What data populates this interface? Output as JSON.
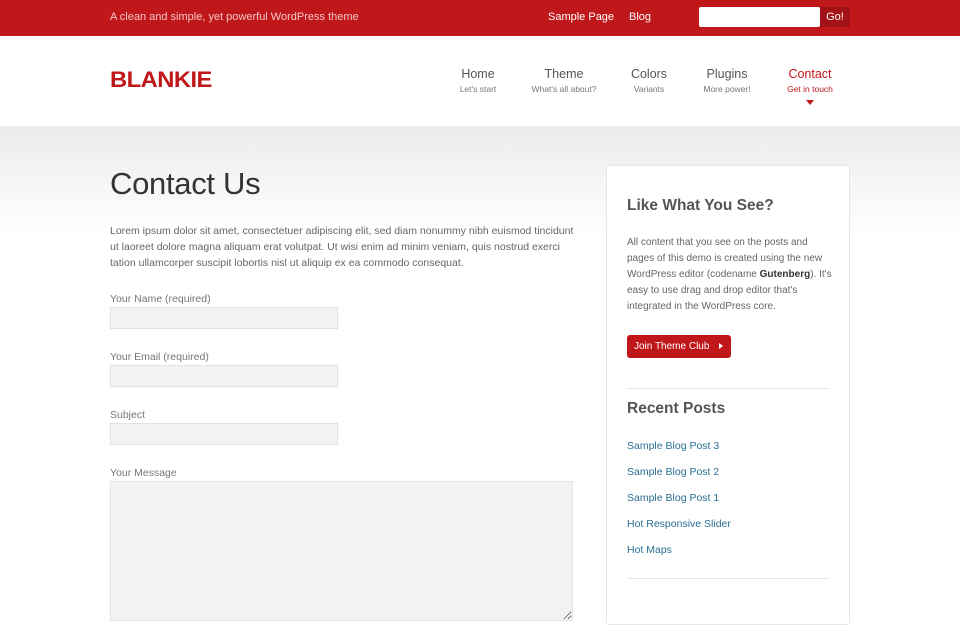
{
  "topbar": {
    "tagline": "A clean and simple, yet powerful WordPress theme",
    "links": [
      "Sample Page",
      "Blog"
    ],
    "search_placeholder": "",
    "search_button": "Go!"
  },
  "header": {
    "logo": "BLANKIE",
    "nav": [
      {
        "title": "Home",
        "sub": "Let's start"
      },
      {
        "title": "Theme",
        "sub": "What's all about?"
      },
      {
        "title": "Colors",
        "sub": "Variants"
      },
      {
        "title": "Plugins",
        "sub": "More power!"
      },
      {
        "title": "Contact",
        "sub": "Get in touch"
      }
    ]
  },
  "main": {
    "title": "Contact Us",
    "intro": "Lorem ipsum dolor sit amet, consectetuer adipiscing elit, sed diam nonummy nibh euismod tincidunt ut laoreet dolore magna aliquam erat volutpat. Ut wisi enim ad minim veniam, quis nostrud exerci tation ullamcorper suscipit lobortis nisl ut aliquip ex ea commodo consequat.",
    "form": {
      "name_label": "Your Name (required)",
      "email_label": "Your Email (required)",
      "subject_label": "Subject",
      "message_label": "Your Message"
    }
  },
  "sidebar": {
    "promo_title": "Like What You See?",
    "promo_text_1": "All content that you see on the posts and pages of this demo is created using the new WordPress editor (codename ",
    "promo_text_bold": "Gutenberg",
    "promo_text_2": "). It's easy to use drag and drop editor that's integrated in the WordPress core.",
    "promo_button": "Join Theme Club",
    "recent_title": "Recent Posts",
    "recent_posts": [
      "Sample Blog Post 3",
      "Sample Blog Post 2",
      "Sample Blog Post 1",
      "Hot Responsive Slider",
      "Hot Maps"
    ]
  },
  "colors": {
    "brand_red": "#c0171b",
    "link_blue": "#2b6f93"
  }
}
